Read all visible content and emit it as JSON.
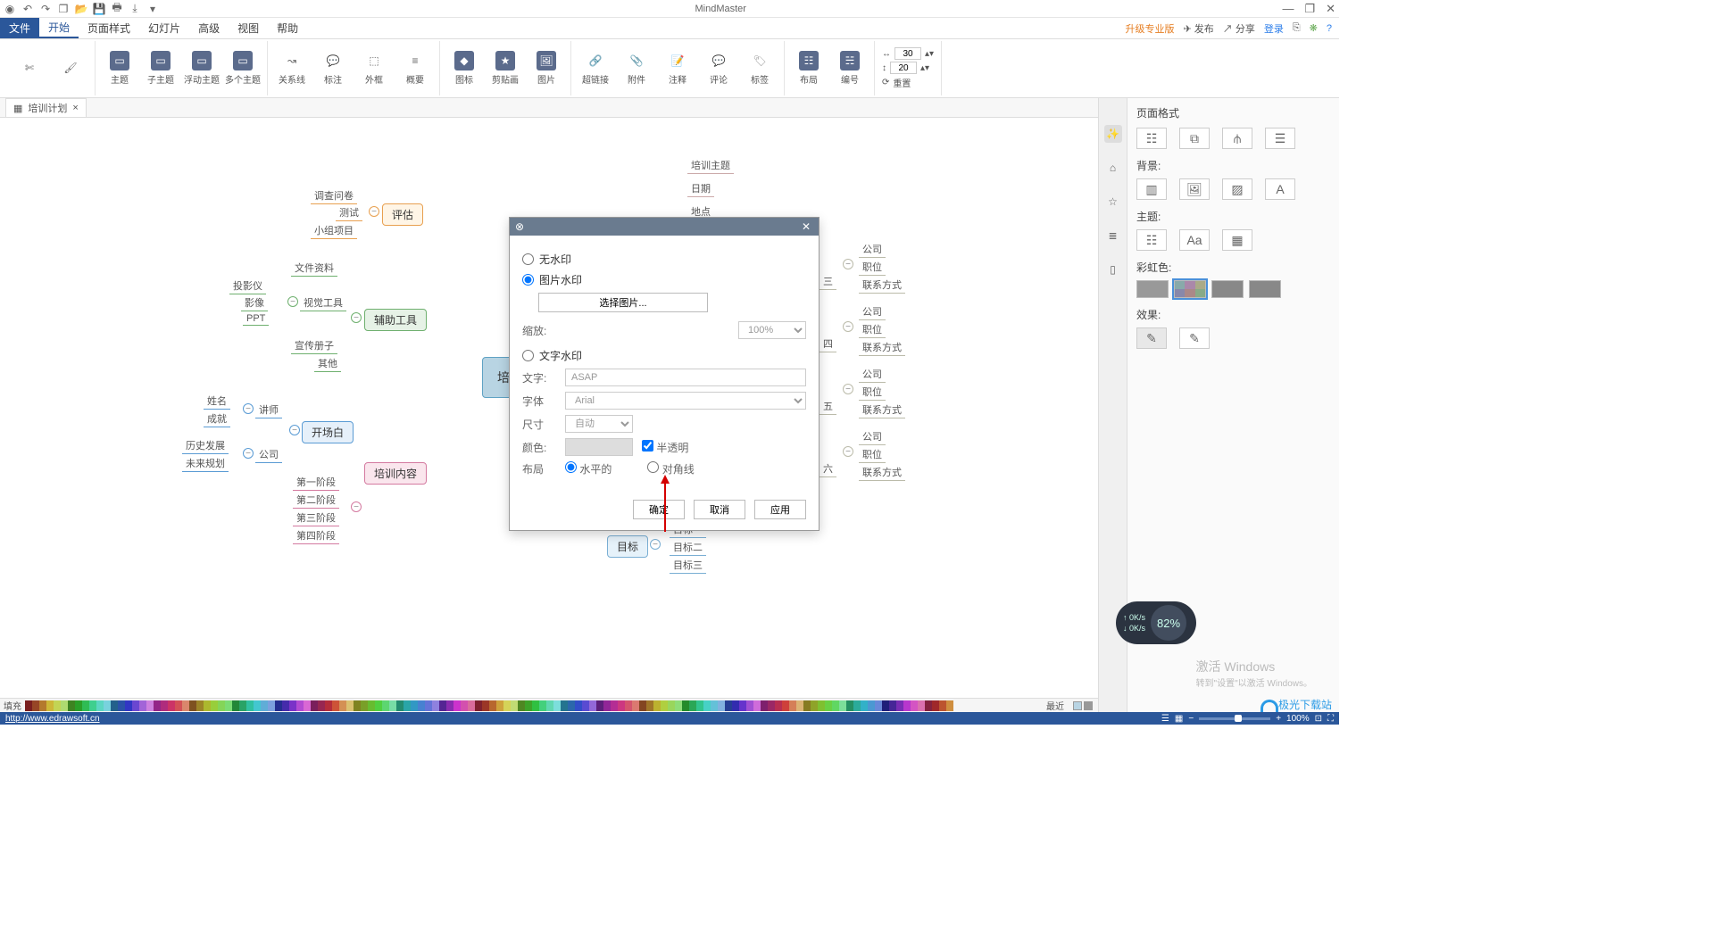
{
  "app": {
    "title": "MindMaster"
  },
  "qat_icons": [
    "orb",
    "new",
    "open",
    "save",
    "print",
    "export",
    "dropdown"
  ],
  "win_controls": [
    "min",
    "max",
    "close"
  ],
  "menus": {
    "file": "文件",
    "tabs": [
      "开始",
      "页面样式",
      "幻灯片",
      "高级",
      "视图",
      "帮助"
    ],
    "active": "开始",
    "right": {
      "upgrade": "升级专业版",
      "publish": "发布",
      "share": "分享",
      "login": "登录"
    }
  },
  "ribbon": {
    "clipboard": [
      "剪切",
      "格式刷"
    ],
    "topics": [
      {
        "label": "主题"
      },
      {
        "label": "子主题"
      },
      {
        "label": "浮动主题"
      },
      {
        "label": "多个主题"
      }
    ],
    "connect": [
      {
        "label": "关系线"
      },
      {
        "label": "标注"
      },
      {
        "label": "外框"
      },
      {
        "label": "概要"
      }
    ],
    "insert": [
      {
        "label": "图标"
      },
      {
        "label": "剪贴画"
      },
      {
        "label": "图片"
      }
    ],
    "insert2": [
      {
        "label": "超链接"
      },
      {
        "label": "附件"
      },
      {
        "label": "注释"
      },
      {
        "label": "评论"
      },
      {
        "label": "标签"
      }
    ],
    "layout": [
      {
        "label": "布局"
      },
      {
        "label": "编号"
      }
    ],
    "size": {
      "w": "30",
      "h": "20",
      "reset": "重置"
    }
  },
  "doctab": {
    "name": "培训计划",
    "close": "×"
  },
  "mindmap": {
    "center": "培训",
    "left": {
      "评估": [
        "调查问卷",
        "测试",
        "小组项目"
      ],
      "辅助工具": {
        "文件资料": [],
        "视觉工具": [
          "投影仪",
          "影像",
          "PPT"
        ],
        "宣传册子": [],
        "其他": []
      },
      "开场白": {
        "讲师": [
          "姓名",
          "成就"
        ],
        "公司": [
          "历史发展",
          "未来规划"
        ]
      },
      "培训内容": [
        "第一阶段",
        "第二阶段",
        "第三阶段",
        "第四阶段"
      ]
    },
    "right": {
      "培训主题": [],
      "日期": [],
      "地点": [],
      "companies": {
        "items": [
          "公司",
          "职位",
          "联系方式"
        ],
        "groups": [
          "三",
          "四",
          "五",
          "六"
        ]
      },
      "预算": [],
      "目标": [
        "目标一",
        "目标二",
        "目标三"
      ]
    }
  },
  "dialog": {
    "radio_none": "无水印",
    "radio_image": "图片水印",
    "choose_image": "选择图片...",
    "scale_label": "缩放:",
    "scale_value": "100%",
    "radio_text": "文字水印",
    "text_label": "文字:",
    "text_value": "ASAP",
    "font_label": "字体",
    "font_value": "Arial",
    "size_label": "尺寸",
    "size_value": "自动",
    "color_label": "颜色:",
    "semi": "半透明",
    "layout_label": "布局",
    "horizontal": "水平的",
    "diagonal": "对角线",
    "ok": "确定",
    "cancel": "取消",
    "apply": "应用"
  },
  "rpanel": {
    "title": "页面格式",
    "sections": {
      "background": "背景:",
      "theme": "主题:",
      "rainbow": "彩虹色:",
      "effect": "效果:"
    }
  },
  "colorbar": {
    "label": "填充",
    "recent": "最近"
  },
  "status": {
    "url": "http://www.edrawsoft.cn",
    "zoom": "100%"
  },
  "widget": {
    "percent": "82%",
    "up": "0K/s",
    "down": "0K/s"
  },
  "activate": {
    "title": "激活 Windows",
    "sub": "转到\"设置\"以激活 Windows。"
  },
  "brand": "极光下载站"
}
